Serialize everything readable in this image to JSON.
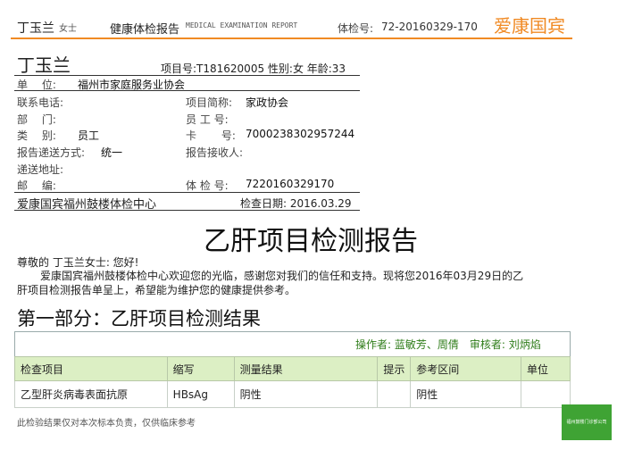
{
  "header": {
    "name": "丁玉兰",
    "gender": "女士",
    "report_title": "健康体检报告",
    "report_title_en": "MEDICAL EXAMINATION REPORT",
    "exam_no_label": "体检号:",
    "exam_no": "72-20160329-170",
    "brand": "爱康国宾"
  },
  "patient": {
    "name": "丁玉兰",
    "summary": "项目号:T181620005  性别:女  年龄:33",
    "unit_label": "单　 位:",
    "unit_value": "福州市家庭服务业协会",
    "phone_label": "联系电话:",
    "project_abbr_label": "项目简称:",
    "project_abbr_value": "家政协会",
    "dept_label": "部　 门:",
    "staff_no_label": "员 工 号:",
    "category_label": "类　 别:",
    "category_value": "员工",
    "card_label": "卡　 　号:",
    "card_value": "7000238302957244",
    "delivery_label": "报告递送方式:",
    "delivery_value": "统一",
    "receiver_label": "报告接收人:",
    "address_label": "递送地址:",
    "postcode_label": "邮　 编:",
    "exam_num_label": "体 检 号:",
    "exam_num_value": "7220160329170",
    "center": "爱康国宾福州鼓楼体检中心",
    "exam_date": "检查日期: 2016.03.29"
  },
  "report": {
    "title": "乙肝项目检测报告",
    "greeting": "尊敬的 丁玉兰女士: 您好!",
    "body_line1": "爱康国宾福州鼓楼体检中心欢迎您的光临，感谢您对我们的信任和支持。现将您2016年03月29日的乙",
    "body_line2": "肝项目检测报告单呈上，希望能为维护您的健康提供参考。"
  },
  "section1": {
    "title": "第一部分：乙肝项目检测结果",
    "operators": "操作者: 蓝敏芳、周倩　审核者: 刘炳焰",
    "columns": [
      "检查项目",
      "缩写",
      "测量结果",
      "提示",
      "参考区间",
      "单位"
    ],
    "rows": [
      [
        "乙型肝炎病毒表面抗原",
        "HBsAg",
        "阴性",
        "",
        "阴性",
        ""
      ]
    ]
  },
  "footer": {
    "note": "此检验结果仅对本次标本负责，仅供临床参考",
    "badge": "福州鼓楼门诊部公司"
  },
  "colors": {
    "brand_orange": "#f08a24",
    "header_green": "#dcefc4",
    "text_green": "#2f7d1a"
  }
}
